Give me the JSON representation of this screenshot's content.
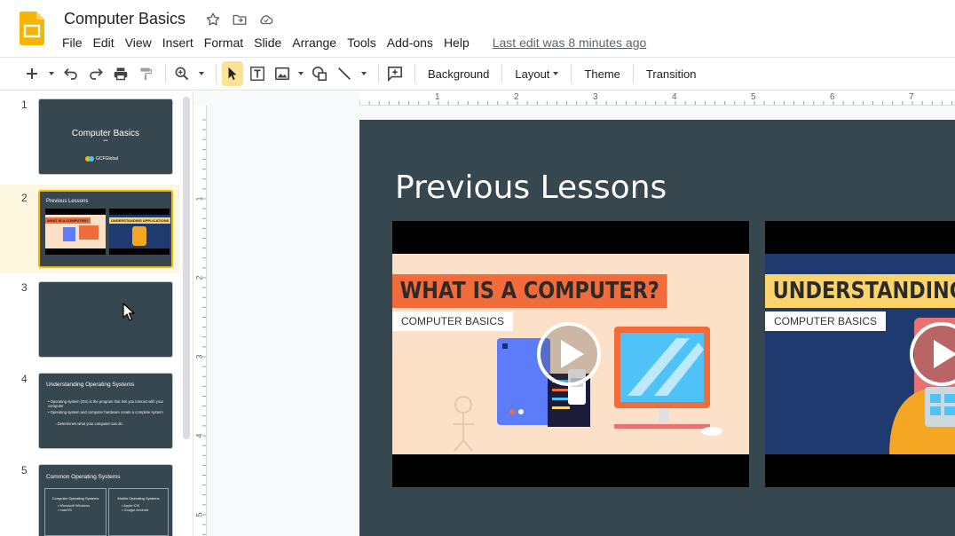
{
  "header": {
    "doc_title": "Computer Basics",
    "title_icons": [
      "star-icon",
      "move-to-folder-icon",
      "cloud-status-icon"
    ],
    "menu": [
      "File",
      "Edit",
      "View",
      "Insert",
      "Format",
      "Slide",
      "Arrange",
      "Tools",
      "Add-ons",
      "Help"
    ],
    "last_edit": "Last edit was 8 minutes ago"
  },
  "toolbar": {
    "background_label": "Background",
    "layout_label": "Layout",
    "theme_label": "Theme",
    "transition_label": "Transition"
  },
  "ruler": {
    "top_marks": [
      "1",
      "2",
      "3",
      "4",
      "5",
      "6",
      "7"
    ],
    "left_marks": [
      "1",
      "2",
      "3",
      "4",
      "5"
    ]
  },
  "filmstrip": {
    "slides": [
      {
        "number": "1",
        "title": "Computer Basics",
        "subtitle": "•••",
        "logo_text": "GCFGlobal"
      },
      {
        "number": "2",
        "title": "Previous Lessons",
        "video1_banner": "WHAT IS A COMPUTER?",
        "video2_banner": "UNDERSTANDING APPLICATIONS"
      },
      {
        "number": "3"
      },
      {
        "number": "4",
        "title": "Understanding Operating Systems",
        "bullets": [
          "Operating system (OS) is the program that lets you interact with your computer",
          "Operating system and computer hardware create a complete system",
          "Determines what your computer can do"
        ]
      },
      {
        "number": "5",
        "title": "Common Operating Systems",
        "col1_header": "Computer Operating Systems",
        "col1_items": [
          "Microsoft Windows",
          "macOS"
        ],
        "col2_header": "Mobile Operating Systems",
        "col2_items": [
          "Apple iOS",
          "Google Android"
        ]
      }
    ]
  },
  "slide": {
    "title": "Previous Lessons",
    "video1": {
      "banner": "WHAT IS A COMPUTER?",
      "tag": "COMPUTER BASICS"
    },
    "video2": {
      "banner": "UNDERSTANDING A",
      "tag": "COMPUTER BASICS"
    }
  },
  "colors": {
    "slide_bg": "#37474f",
    "accent_yellow": "#f4b400",
    "banner_orange": "#f26b3a",
    "banner_yellow": "#fcd46b",
    "video1_bg": "#fce0c8",
    "video2_bg": "#1f3a6e"
  }
}
